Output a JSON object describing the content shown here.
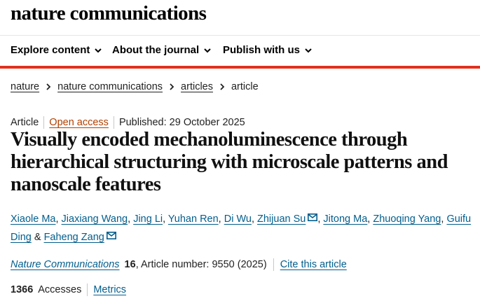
{
  "site": {
    "logo": "nature communications"
  },
  "nav": {
    "items": [
      {
        "label": "Explore content"
      },
      {
        "label": "About the journal"
      },
      {
        "label": "Publish with us"
      }
    ]
  },
  "breadcrumb": {
    "items": [
      "nature",
      "nature communications",
      "articles"
    ],
    "current": "article"
  },
  "article": {
    "type": "Article",
    "access": "Open access",
    "published": "Published: 29 October 2025",
    "title": "Visually encoded mechanoluminescence through hierarchical structuring with microscale patterns and nanoscale features",
    "authors": [
      "Xiaole Ma",
      "Jiaxiang Wang",
      "Jing Li",
      "Yuhan Ren",
      "Di Wu",
      "Zhijuan Su",
      "Jitong Ma",
      "Zhuoqing Yang",
      "Guifu Ding",
      "Faheng Zang"
    ],
    "corresponding_marker": "mail-icon",
    "citation": {
      "journal": "Nature Communications",
      "volume": "16",
      "article_number": ", Article number: 9550 (2025)",
      "cite_link": "Cite this article"
    },
    "metrics": {
      "accesses_count": "1366",
      "accesses_label": "Accesses",
      "metrics_link": "Metrics"
    }
  },
  "colors": {
    "accent_red": "#e0321f",
    "link_blue": "#025e8d",
    "open_access": "#b04000"
  }
}
